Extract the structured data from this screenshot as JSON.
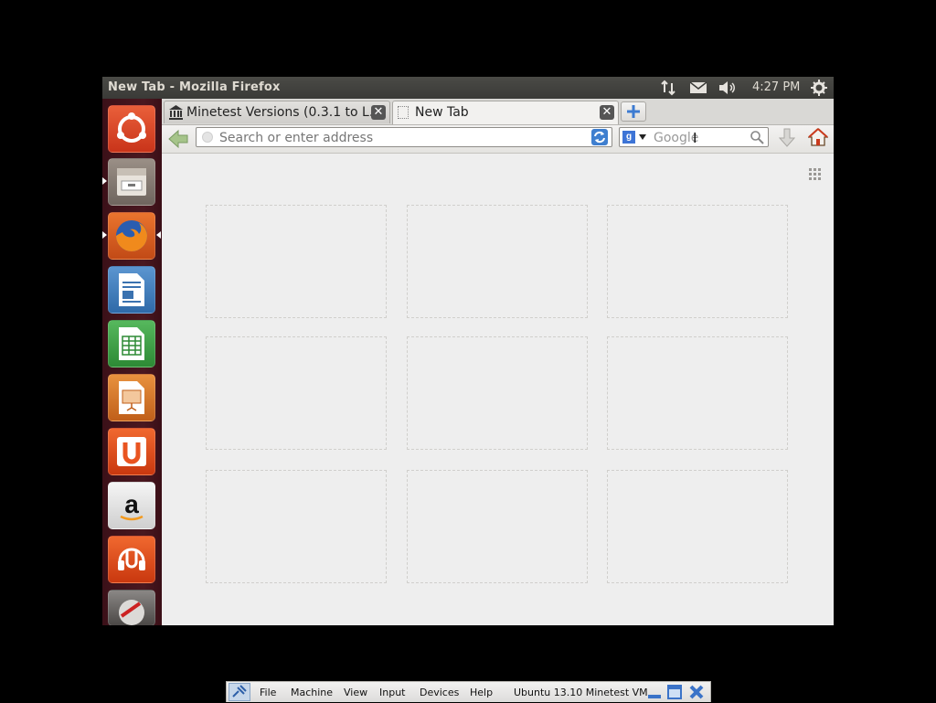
{
  "window": {
    "title": "New Tab - Mozilla Firefox"
  },
  "panel": {
    "clock": "4:27 PM"
  },
  "launcher": {
    "items": [
      {
        "name": "dash-home-icon"
      },
      {
        "name": "files-icon"
      },
      {
        "name": "firefox-icon"
      },
      {
        "name": "libreoffice-writer-icon"
      },
      {
        "name": "libreoffice-calc-icon"
      },
      {
        "name": "libreoffice-impress-icon"
      },
      {
        "name": "ubuntu-software-center-icon"
      },
      {
        "name": "amazon-icon"
      },
      {
        "name": "ubuntu-one-music-icon"
      },
      {
        "name": "system-settings-icon"
      }
    ]
  },
  "tabs": [
    {
      "label": "Minetest Versions (0.3.1 to L...",
      "active": false
    },
    {
      "label": "New Tab",
      "active": true
    }
  ],
  "navbar": {
    "url_placeholder": "Search or enter address",
    "search_placeholder": "Google"
  },
  "content": {
    "tile_count": 9
  },
  "vbox": {
    "menu": [
      "File",
      "Machine",
      "View",
      "Input",
      "Devices",
      "Help"
    ],
    "title": "Ubuntu 13.10 Minetest VM"
  },
  "colors": {
    "launcher_bg": "#4a1820",
    "panel_bg": "#3a3a37",
    "accent_orange": "#e95420"
  }
}
